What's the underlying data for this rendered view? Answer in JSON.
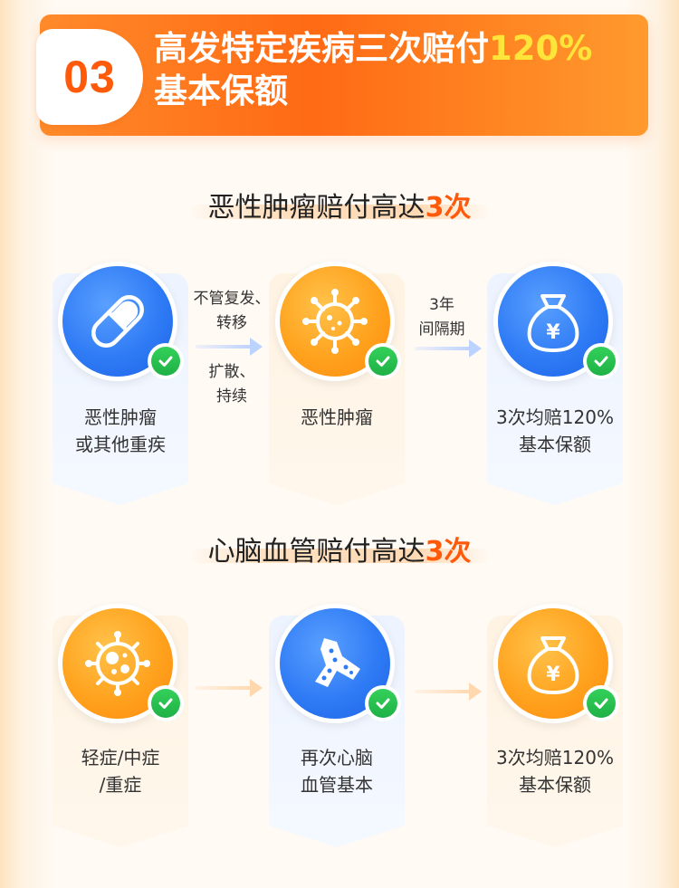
{
  "header": {
    "number": "03",
    "title_main": "高发特定疾病三次赔付",
    "title_highlight": "120%",
    "title_line2": "基本保额"
  },
  "section1": {
    "title_text": "恶性肿瘤赔付高达",
    "title_num": "3次",
    "cards": [
      {
        "icon": "capsule-icon",
        "label_line1": "恶性肿瘤",
        "label_line2": "或其他重疾"
      },
      {
        "icon": "virus-icon",
        "label_line1": "恶性肿瘤",
        "label_line2": ""
      },
      {
        "icon": "money-bag-icon",
        "label_line1": "3次均赔120%",
        "label_line2": "基本保额"
      }
    ],
    "arrow1": {
      "top_line1": "不管复发、",
      "top_line2": "转移",
      "bottom_line1": "扩散、",
      "bottom_line2": "持续"
    },
    "arrow2": {
      "top_line1": "3年",
      "top_line2": "间隔期"
    }
  },
  "section2": {
    "title_text": "心脑血管赔付高达",
    "title_num": "3次",
    "cards": [
      {
        "icon": "bacteria-icon",
        "label_line1": "轻症/中症",
        "label_line2": "/重症"
      },
      {
        "icon": "blood-vessel-icon",
        "label_line1": "再次心脑",
        "label_line2": "血管基本"
      },
      {
        "icon": "money-bag-icon",
        "label_line1": "3次均赔120%",
        "label_line2": "基本保额"
      }
    ]
  },
  "colors": {
    "accent_orange": "#ff5a0a",
    "highlight_yellow": "#ffe43a",
    "blue": "#2f7bf5",
    "orange": "#ffa21e",
    "check_green": "#22b54a"
  }
}
